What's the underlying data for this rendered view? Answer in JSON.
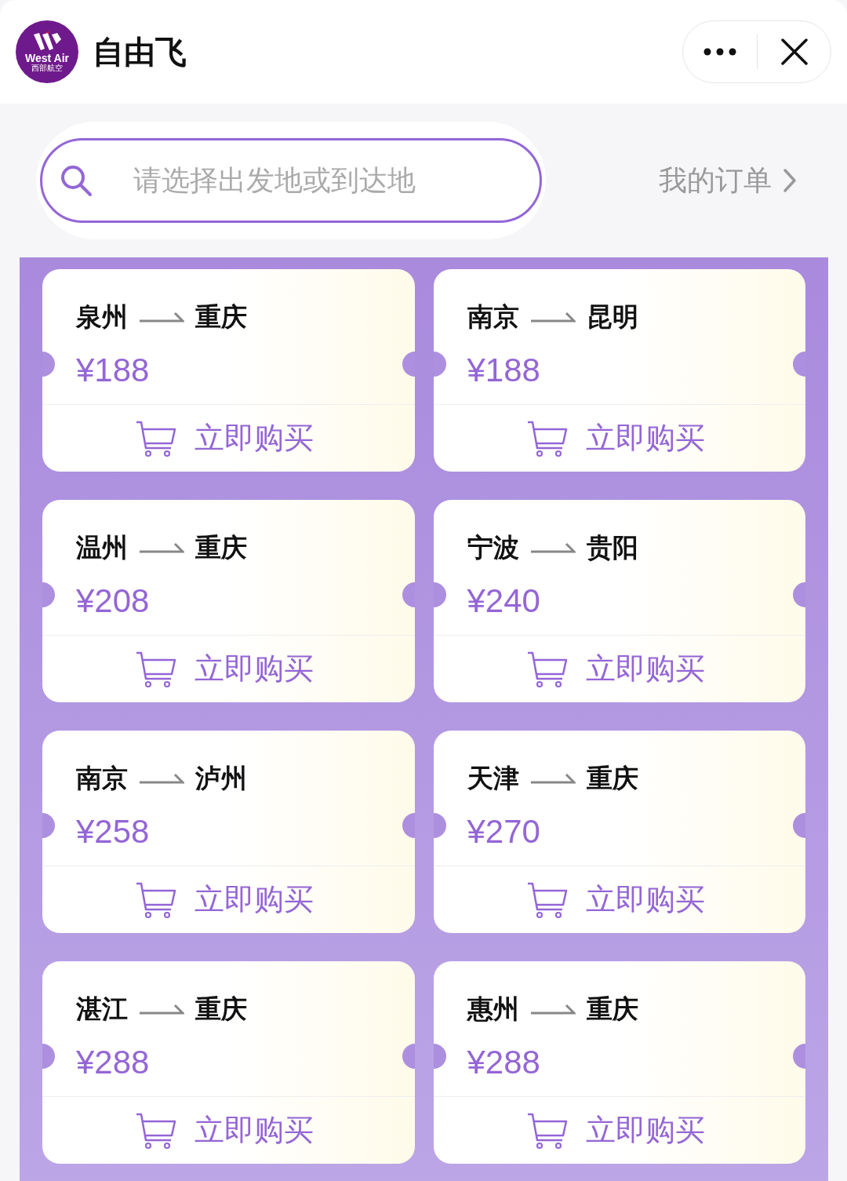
{
  "header": {
    "logo": {
      "text": "West Air",
      "subtext": "西部航空"
    },
    "title": "自由飞"
  },
  "search": {
    "placeholder": "请选择出发地或到达地"
  },
  "orders_link": "我的订单",
  "routes": [
    {
      "from": "泉州",
      "to": "重庆",
      "price": "¥188",
      "button": "立即购买"
    },
    {
      "from": "南京",
      "to": "昆明",
      "price": "¥188",
      "button": "立即购买"
    },
    {
      "from": "温州",
      "to": "重庆",
      "price": "¥208",
      "button": "立即购买"
    },
    {
      "from": "宁波",
      "to": "贵阳",
      "price": "¥240",
      "button": "立即购买"
    },
    {
      "from": "南京",
      "to": "泸州",
      "price": "¥258",
      "button": "立即购买"
    },
    {
      "from": "天津",
      "to": "重庆",
      "price": "¥270",
      "button": "立即购买"
    },
    {
      "from": "湛江",
      "to": "重庆",
      "price": "¥288",
      "button": "立即购买"
    },
    {
      "from": "惠州",
      "to": "重庆",
      "price": "¥288",
      "button": "立即购买"
    }
  ]
}
